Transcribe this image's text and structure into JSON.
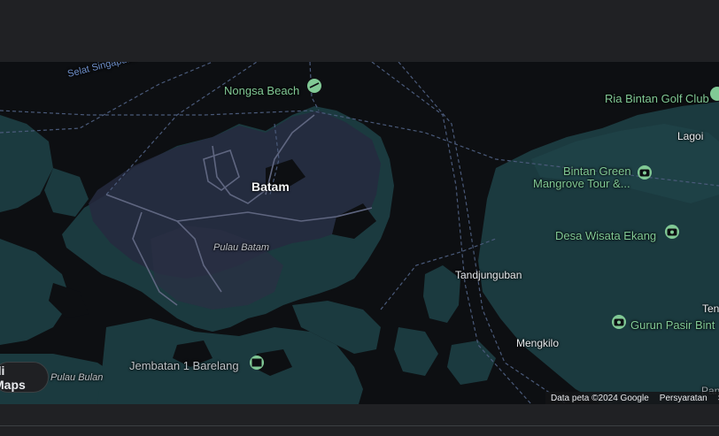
{
  "map": {
    "water_label": "Selat Singapura",
    "city": "Batam",
    "islands": {
      "pulau_batam": "Pulau Batam",
      "pulau_bulan": "Pulau Bulan"
    },
    "places": {
      "lagoi": "Lagoi",
      "tandjunguban": "Tandjunguban",
      "mengkilo": "Mengkilo",
      "ten": "Ten",
      "panyan": "Panyan"
    },
    "pois": {
      "nongsa": "Nongsa Beach",
      "ria_bintan": "Ria Bintan Golf Club",
      "bintan_green_1": "Bintan Green",
      "bintan_green_2": "Mangrove Tour &...",
      "desa_wisata": "Desa Wisata Ekang",
      "gurun_pasir": "Gurun Pasir Bint",
      "jembatan": "Jembatan 1 Barelang"
    },
    "open_button": "di Maps",
    "attribution": {
      "data": "Data peta ©2024 Google",
      "terms": "Persyaratan",
      "extra": "S"
    },
    "colors": {
      "land": "#1b3a3f",
      "urban": "#2b2f45",
      "water": "#0d0f12",
      "poi": "#81c995"
    },
    "icons": {
      "beach": "beach-umbrella-icon",
      "golf": "golf-icon",
      "camera": "camera-icon",
      "landmark": "landmark-icon"
    }
  }
}
